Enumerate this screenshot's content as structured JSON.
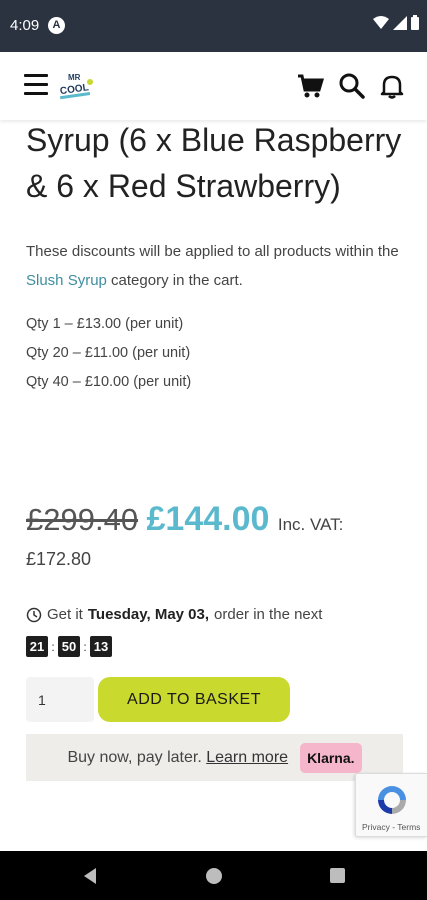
{
  "status_bar": {
    "time": "4:09",
    "badge": "A"
  },
  "header": {
    "logo_text_top": "MR",
    "logo_text_bottom": "COOL"
  },
  "product": {
    "title": "Syrup (6 x Blue Raspberry & 6 x Red Strawberry)",
    "discount_note_before": "These discounts will be applied to all products within the ",
    "discount_link": "Slush Syrup",
    "discount_note_after": " category in the cart.",
    "tiers": [
      "Qty 1 – £13.00 (per unit)",
      "Qty 20 – £11.00 (per unit)",
      "Qty 40 – £10.00 (per unit)"
    ],
    "old_price": "£299.40",
    "new_price": "£144.00",
    "vat_label": "Inc. VAT:",
    "vat_amount": "£172.80"
  },
  "delivery": {
    "prefix": "Get it",
    "date": "Tuesday, May 03,",
    "suffix": "order in the next",
    "countdown": [
      "21",
      "50",
      "13"
    ]
  },
  "cart": {
    "quantity": "1",
    "add_button": "ADD TO BASKET"
  },
  "klarna": {
    "text": "Buy now, pay later.",
    "link": "Learn more",
    "badge": "Klarna."
  },
  "recaptcha": {
    "links": "Privacy - Terms"
  },
  "colors": {
    "accent": "#5ab9cc",
    "button": "#c9d92e",
    "status_bar": "#2b3240",
    "klarna_pink": "#f5b6cb"
  }
}
